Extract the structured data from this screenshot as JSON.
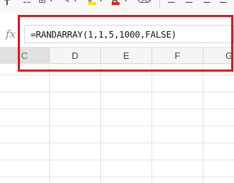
{
  "toolbar": {
    "icons": [
      "border-icon",
      "cell-style-icon",
      "table-icon",
      "paint-format-icon",
      "highlight-icon",
      "font-color-icon",
      "clear-format-icon",
      "align-left-icon",
      "align-center-icon",
      "align-right-icon"
    ],
    "font_color_glyph": "A",
    "highlight_color": "#ffe000",
    "font_color": "#e0201b"
  },
  "formula_bar": {
    "fx_label": "fx",
    "formula": "=RANDARRAY(1,1,5,1000,FALSE)"
  },
  "columns": [
    {
      "label": "C",
      "selected": true
    },
    {
      "label": "D",
      "selected": false
    },
    {
      "label": "E",
      "selected": false
    },
    {
      "label": "F",
      "selected": false
    },
    {
      "label": "G",
      "selected": false
    }
  ],
  "annotation": {
    "color": "#e2141c"
  }
}
